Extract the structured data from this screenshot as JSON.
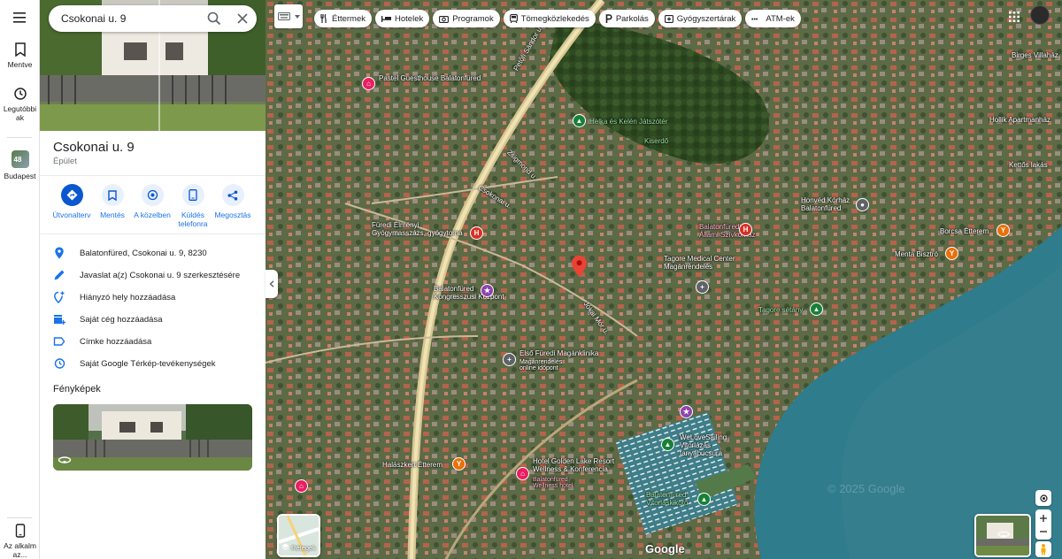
{
  "rail": {
    "saved": "Mentve",
    "recent": "Legutóbbi\nak",
    "budapest_badge": "48",
    "budapest": "Budapest",
    "app": "Az alkalmaz..."
  },
  "search": {
    "value": "Csokonai u. 9"
  },
  "place": {
    "title": "Csokonai u. 9",
    "subtitle": "Épület"
  },
  "actions": [
    {
      "label": "Útvonalterv"
    },
    {
      "label": "Mentés"
    },
    {
      "label": "A közelben"
    },
    {
      "label": "Küldés telefonra"
    },
    {
      "label": "Megosztás"
    }
  ],
  "info_rows": [
    {
      "label": "Balatonfüred, Csokonai u. 9, 8230",
      "icon": "location-pin-icon"
    },
    {
      "label": "Javaslat a(z) Csokonai u. 9 szerkesztésére",
      "icon": "pencil-icon"
    },
    {
      "label": "Hiányzó hely hozzáadása",
      "icon": "add-place-icon"
    },
    {
      "label": "Saját cég hozzáadása",
      "icon": "add-business-icon"
    },
    {
      "label": "Címke hozzáadása",
      "icon": "label-icon"
    },
    {
      "label": "Saját Google Térkép-tevékenységek",
      "icon": "history-icon"
    }
  ],
  "photos_title": "Fényképek",
  "chips": [
    {
      "label": "Éttermek",
      "icon": "restaurant-icon"
    },
    {
      "label": "Hotelek",
      "icon": "hotel-icon"
    },
    {
      "label": "Programok",
      "icon": "camera-icon"
    },
    {
      "label": "Tömegközlekedés",
      "icon": "transit-icon"
    },
    {
      "label": "Parkolás",
      "icon": "parking-icon"
    },
    {
      "label": "Gyógyszertárak",
      "icon": "pharmacy-icon"
    },
    {
      "label": "ATM-ek",
      "icon": "atm-icon"
    }
  ],
  "map": {
    "layers_label": "Rétegek",
    "google": "Google",
    "watermark": "© 2025 Google",
    "labels": {
      "pastel": "Pastel Guesthouse\nBalatonfüred",
      "helka": "Helka és Kelén Játszótér",
      "kiserdo": "Kiserdő",
      "honved": "Honvéd Kórház\nBalatonfüred",
      "allami": "Balatonfüredi\nÁllami Szívkórház",
      "gyogy": "Füredi Élményi\nGyógymasszázs, gyógytorna",
      "terapia": "és...terápia",
      "kongresszusi": "Balatonfüred\nKongresszusi Központ",
      "tagore_med": "Tagore Medical Center\nMagánrendelés",
      "tagore_setany": "Tagore sétány",
      "borcsa": "Borcsa Étterem",
      "menta": "Menta Bisztró",
      "hollik": "Hollik Apartmanház",
      "birges": "Birges Villaház",
      "kettos": "Kettős lakás",
      "elso": "Első Füredi Magánklinika",
      "elso_sub": "Magánrendelés\nonline időpont",
      "sailing": "WeLoveSailing\nVitorlázás\ntanyabucsúra",
      "golden": "Hotel Golden Lake Resort\nWellness & Konferencia",
      "golden_sub": "Balatonfüred\nWellness hotel",
      "halaszkert": "Halászkert Étterem",
      "vitorlas": "Balatonfüred\nVitorláskikötő",
      "csokonai": "Csokonai u.",
      "zsigmond": "Zsigmond u.",
      "petofi": "Petőfi Sándor u.",
      "jokai": "Jókai Mór u."
    }
  },
  "colors": {
    "accent": "#0b57d0",
    "pin_red": "#ea4335",
    "water": "#2f7c8c"
  }
}
